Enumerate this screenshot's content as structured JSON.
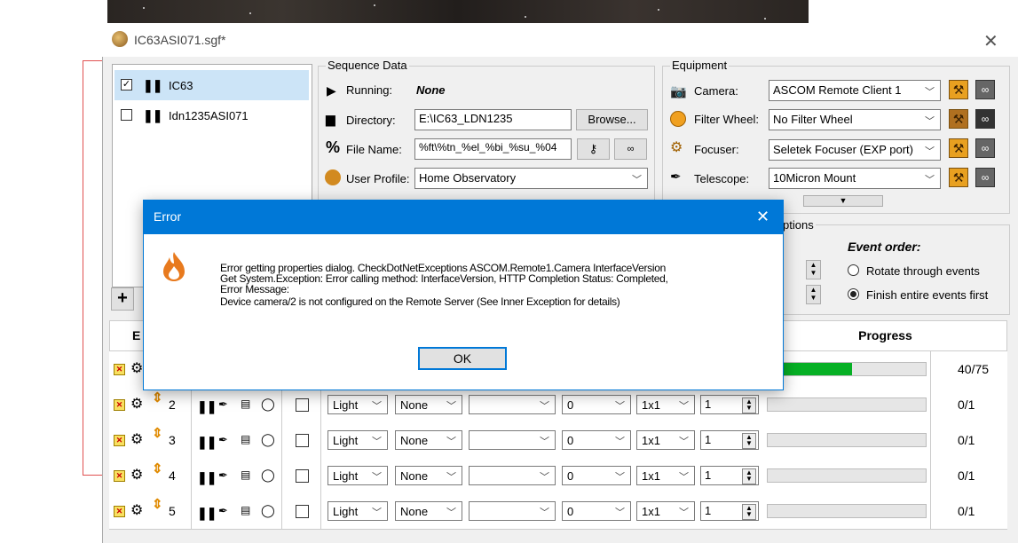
{
  "window": {
    "title": "IC63ASI071.sgf*",
    "close": "✕"
  },
  "targets": [
    {
      "name": "IC63",
      "checked": true,
      "selected": true
    },
    {
      "name": "Idn1235ASI071",
      "checked": false,
      "selected": false
    }
  ],
  "add_button": "+",
  "sequence_data": {
    "group_label": "Sequence Data",
    "running_label": "Running:",
    "running_value": "None",
    "directory_label": "Directory:",
    "directory_value": "E:\\IC63_LDN1235",
    "browse_label": "Browse...",
    "filename_label": "File Name:",
    "filename_value": "%ft\\%tn_%el_%bi_%su_%04",
    "profile_label": "User Profile:",
    "profile_value": "Home Observatory"
  },
  "equipment": {
    "group_label": "Equipment",
    "camera_label": "Camera:",
    "camera_value": "ASCOM Remote Client 1",
    "filter_label": "Filter Wheel:",
    "filter_value": "No Filter Wheel",
    "focuser_label": "Focuser:",
    "focuser_value": "Seletek Focuser (EXP port)",
    "telescope_label": "Telescope:",
    "telescope_value": "10Micron Mount"
  },
  "options": {
    "group_label": "ptions",
    "event_order_label": "Event order:",
    "rotate_label": "Rotate through events",
    "finish_label": "Finish entire events first",
    "selected": "finish"
  },
  "grid": {
    "header_event": "E",
    "header_progress": "Progress",
    "rows": [
      {
        "num": "",
        "type": "",
        "filter": "",
        "suffix": "",
        "bin": "",
        "exp": "",
        "progress": 0.533,
        "count": "40/75"
      },
      {
        "num": "2",
        "type": "Light",
        "filter": "None",
        "suffix": "0",
        "bin": "1x1",
        "exp": "1",
        "progress": 0,
        "count": "0/1"
      },
      {
        "num": "3",
        "type": "Light",
        "filter": "None",
        "suffix": "0",
        "bin": "1x1",
        "exp": "1",
        "progress": 0,
        "count": "0/1"
      },
      {
        "num": "4",
        "type": "Light",
        "filter": "None",
        "suffix": "0",
        "bin": "1x1",
        "exp": "1",
        "progress": 0,
        "count": "0/1"
      },
      {
        "num": "5",
        "type": "Light",
        "filter": "None",
        "suffix": "0",
        "bin": "1x1",
        "exp": "1",
        "progress": 0,
        "count": "0/1"
      }
    ]
  },
  "dialog": {
    "title": "Error",
    "close": "✕",
    "line1": "Error getting properties dialog.  CheckDotNetExceptions ASCOM.Remote1.Camera InterfaceVersion",
    "line2": "Get System.Exception: Error calling method: InterfaceVersion, HTTP Completion Status: Completed,",
    "line3": "Error Message:",
    "line4": "Device camera/2 is not configured on the Remote Server (See Inner Exception for details)",
    "ok_label": "OK"
  },
  "colors": {
    "accent": "#0078d7",
    "progress": "#06b025",
    "error_icon": "#e87a1e"
  }
}
